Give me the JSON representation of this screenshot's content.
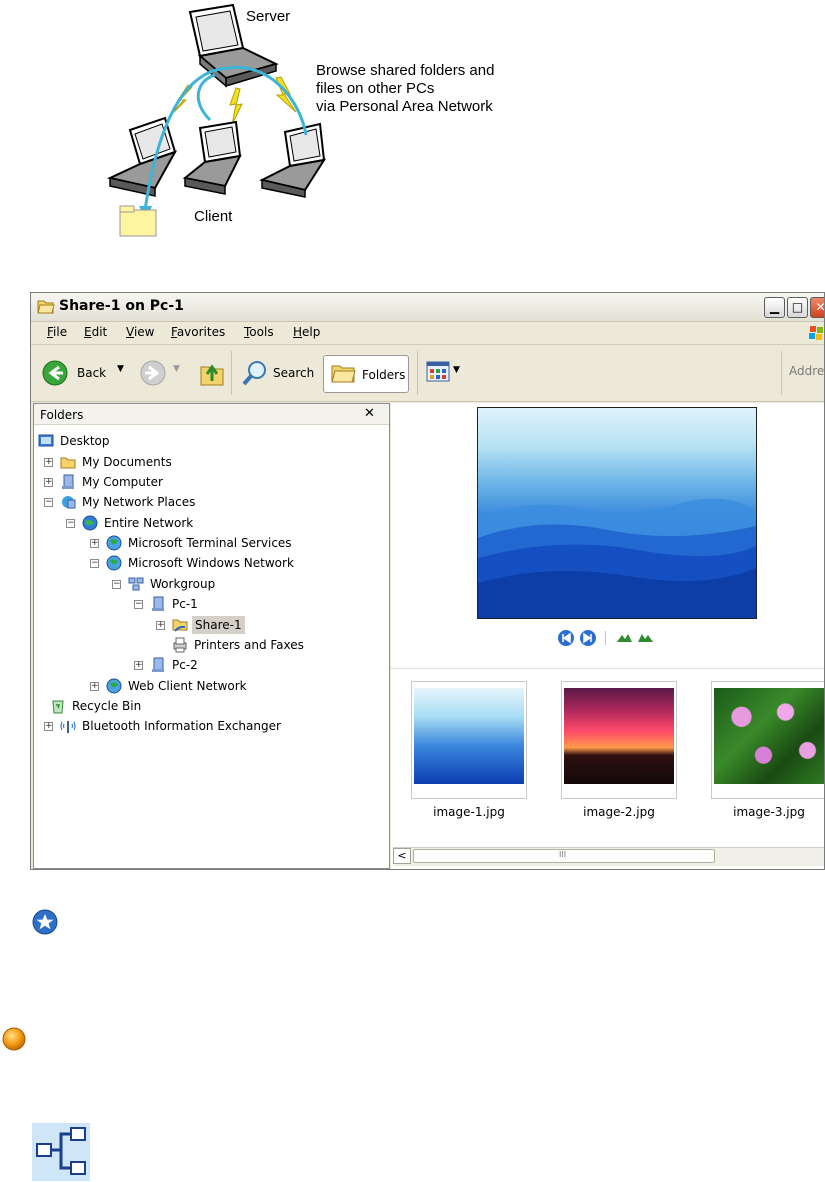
{
  "diagram": {
    "server_label": "Server",
    "caption_lines": [
      "Browse shared folders and",
      "files on other PCs",
      "via Personal Area Network"
    ],
    "client_label": "Client"
  },
  "window": {
    "title": "Share-1 on Pc-1",
    "menus": [
      "File",
      "Edit",
      "View",
      "Favorites",
      "Tools",
      "Help"
    ],
    "toolbar": {
      "back": "Back",
      "search": "Search",
      "folders": "Folders",
      "address": "Addre"
    },
    "folders_pane": {
      "title": "Folders",
      "close": "✕",
      "items": [
        {
          "label": "Desktop",
          "icon": "desktop-icon",
          "expander": ""
        },
        {
          "label": "My Documents",
          "icon": "folder-icon",
          "expander": "+"
        },
        {
          "label": "My Computer",
          "icon": "computer-icon",
          "expander": "+"
        },
        {
          "label": "My Network Places",
          "icon": "network-places-icon",
          "expander": "−"
        },
        {
          "label": "Entire Network",
          "icon": "globe-icon",
          "expander": "−"
        },
        {
          "label": "Microsoft Terminal Services",
          "icon": "network-icon",
          "expander": "+"
        },
        {
          "label": "Microsoft Windows Network",
          "icon": "network-icon",
          "expander": "−"
        },
        {
          "label": "Workgroup",
          "icon": "workgroup-icon",
          "expander": "−"
        },
        {
          "label": "Pc-1",
          "icon": "computer-icon",
          "expander": "−"
        },
        {
          "label": "Share-1",
          "icon": "shared-folder-icon",
          "expander": "+",
          "selected": true
        },
        {
          "label": "Printers and Faxes",
          "icon": "printer-icon",
          "expander": ""
        },
        {
          "label": "Pc-2",
          "icon": "computer-icon",
          "expander": "+"
        },
        {
          "label": "Web Client Network",
          "icon": "network-icon",
          "expander": "+"
        },
        {
          "label": "Recycle Bin",
          "icon": "recycle-bin-icon",
          "expander": ""
        },
        {
          "label": "Bluetooth Information Exchanger",
          "icon": "bluetooth-icon",
          "expander": "+"
        }
      ]
    },
    "thumbnails": [
      {
        "caption": "image-1.jpg"
      },
      {
        "caption": "image-2.jpg"
      },
      {
        "caption": "image-3.jpg"
      }
    ],
    "scroll_grip": "III",
    "scroll_left": "<"
  },
  "colors": {
    "xp_bg": "#ece9d8",
    "selected_bg": "#d4d0c8",
    "wireless": "#f0e020",
    "arrow": "#3cb4d8",
    "folder": "#fff4a0"
  }
}
